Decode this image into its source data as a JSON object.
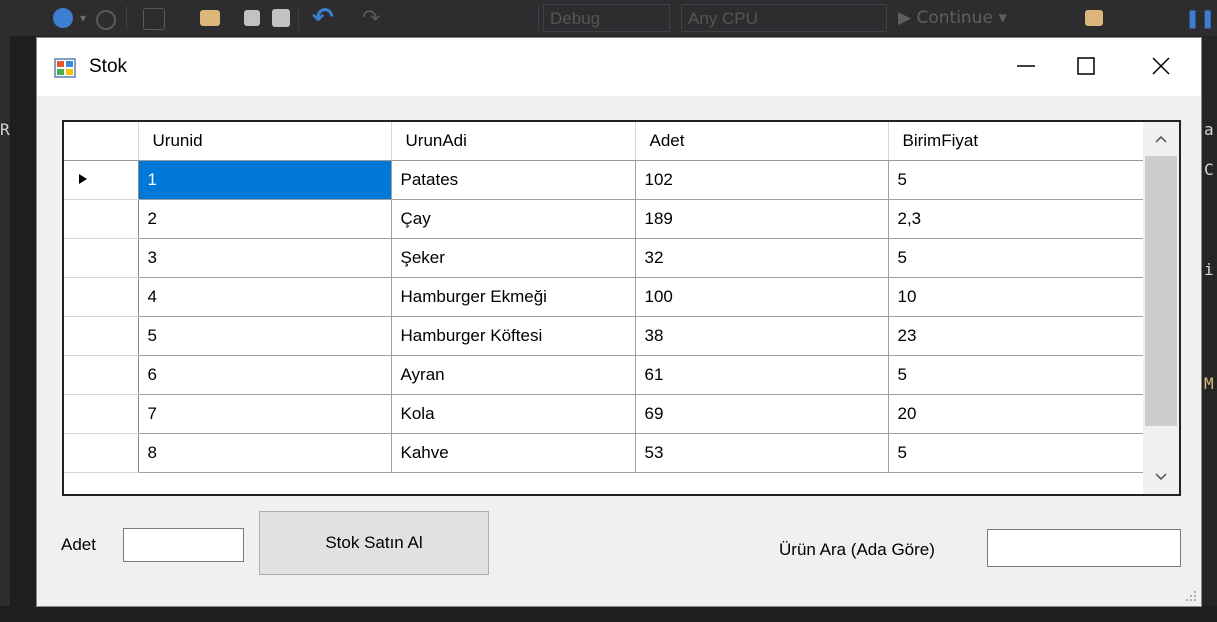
{
  "vs": {
    "toolbar": {
      "config_combo": "Debug",
      "platform_combo": "Any CPU",
      "continue_label": "▶ Continue ▾"
    },
    "left_fragment": "R",
    "right_fragments": [
      "a",
      "C",
      "i",
      "M"
    ]
  },
  "window": {
    "title": "Stok"
  },
  "grid": {
    "columns": [
      "Urunid",
      "UrunAdi",
      "Adet",
      "BirimFiyat"
    ],
    "rows": [
      [
        "1",
        "Patates",
        "102",
        "5"
      ],
      [
        "2",
        "Çay",
        "189",
        "2,3"
      ],
      [
        "3",
        "Şeker",
        "32",
        "5"
      ],
      [
        "4",
        "Hamburger Ekmeği",
        "100",
        "10"
      ],
      [
        "5",
        "Hamburger Köftesi",
        "38",
        "23"
      ],
      [
        "6",
        "Ayran",
        "61",
        "5"
      ],
      [
        "7",
        "Kola",
        "69",
        "20"
      ],
      [
        "8",
        "Kahve",
        "53",
        "5"
      ]
    ],
    "selected_row": 0
  },
  "form": {
    "adet_label": "Adet",
    "adet_value": "",
    "buy_button": "Stok Satın Al",
    "search_label": "Ürün Ara (Ada Göre)",
    "search_value": ""
  },
  "colors": {
    "selection": "#0078d7",
    "vs_background": "#1e1e1e",
    "form_background": "#f0f0f0"
  }
}
